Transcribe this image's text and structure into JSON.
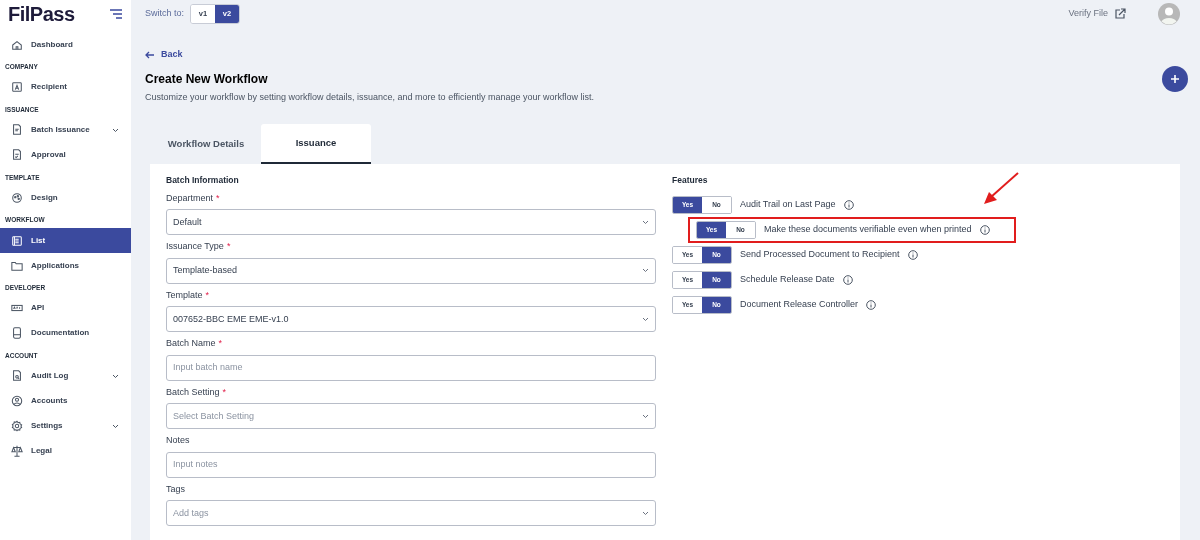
{
  "brand": "FilPass",
  "sidebar": {
    "sections": [
      {
        "items": [
          {
            "label": "Dashboard",
            "kind": "link",
            "selected": false
          }
        ]
      },
      {
        "heading": "COMPANY",
        "items": [
          {
            "label": "Recipient",
            "kind": "link",
            "selected": false
          }
        ]
      },
      {
        "heading": "ISSUANCE",
        "items": [
          {
            "label": "Batch Issuance",
            "kind": "group",
            "selected": false
          },
          {
            "label": "Approval",
            "kind": "link",
            "selected": false
          }
        ]
      },
      {
        "heading": "TEMPLATE",
        "items": [
          {
            "label": "Design",
            "kind": "link",
            "selected": false
          }
        ]
      },
      {
        "heading": "WORKFLOW",
        "items": [
          {
            "label": "List",
            "kind": "link",
            "selected": true
          },
          {
            "label": "Applications",
            "kind": "link",
            "selected": false
          }
        ]
      },
      {
        "heading": "DEVELOPER",
        "items": [
          {
            "label": "API",
            "kind": "link",
            "selected": false
          },
          {
            "label": "Documentation",
            "kind": "link",
            "selected": false
          }
        ]
      },
      {
        "heading": "ACCOUNT",
        "items": [
          {
            "label": "Audit Log",
            "kind": "group",
            "selected": false
          },
          {
            "label": "Accounts",
            "kind": "link",
            "selected": false
          },
          {
            "label": "Settings",
            "kind": "group",
            "selected": false
          },
          {
            "label": "Legal",
            "kind": "link",
            "selected": false
          }
        ]
      }
    ]
  },
  "topbar": {
    "switch_label": "Switch to:",
    "versions": [
      {
        "label": "v1",
        "selected": false
      },
      {
        "label": "v2",
        "selected": true
      }
    ],
    "verify_link": "Verify File"
  },
  "back": "Back",
  "title": "Create New Workflow",
  "subtitle": "Customize your workflow by setting workflow details, issuance, and more to efficiently manage your workflow list.",
  "tabs": [
    {
      "label": "Workflow Details",
      "selected": false
    },
    {
      "label": "Issuance",
      "selected": true
    }
  ],
  "batch_information": {
    "heading": "Batch Information",
    "fields": [
      {
        "label": "Department",
        "required_marker": "*",
        "kind": "select",
        "value": "Default"
      },
      {
        "label": "Issuance Type",
        "required_marker": "*",
        "kind": "select",
        "value": "Template-based"
      },
      {
        "label": "Template",
        "required_marker": "*",
        "kind": "select",
        "value": "007652-BBC EME EME-v1.0"
      },
      {
        "label": "Batch Name",
        "required_marker": "*",
        "kind": "input",
        "placeholder": "Input batch name"
      },
      {
        "label": "Batch Setting",
        "required_marker": "*",
        "kind": "select",
        "placeholder": "Select Batch Setting"
      },
      {
        "label": "Notes",
        "kind": "input",
        "placeholder": "Input notes"
      },
      {
        "label": "Tags",
        "kind": "select",
        "placeholder": "Add tags"
      }
    ]
  },
  "features": {
    "heading": "Features",
    "items": [
      {
        "label": "Audit Trail on Last Page",
        "highlighted": false,
        "options": [
          {
            "label": "Yes",
            "selected": true
          },
          {
            "label": "No",
            "selected": false
          }
        ],
        "children": [
          {
            "label": "Make these documents verifiable even when printed",
            "highlighted": true,
            "options": [
              {
                "label": "Yes",
                "selected": true
              },
              {
                "label": "No",
                "selected": false
              }
            ]
          }
        ]
      },
      {
        "label": "Send Processed Document to Recipient",
        "highlighted": false,
        "options": [
          {
            "label": "Yes",
            "selected": false
          },
          {
            "label": "No",
            "selected": true
          }
        ]
      },
      {
        "label": "Schedule Release Date",
        "highlighted": false,
        "options": [
          {
            "label": "Yes",
            "selected": false
          },
          {
            "label": "No",
            "selected": true
          }
        ]
      },
      {
        "label": "Document Release Controller",
        "highlighted": false,
        "options": [
          {
            "label": "Yes",
            "selected": false
          },
          {
            "label": "No",
            "selected": true
          }
        ]
      }
    ]
  }
}
